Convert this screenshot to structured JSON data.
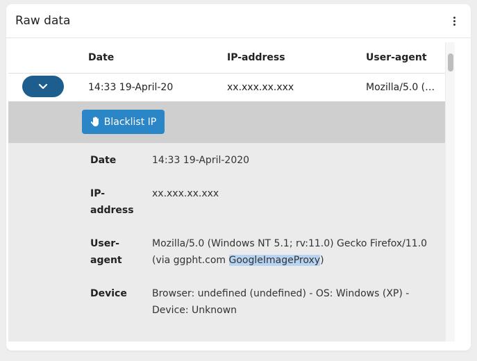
{
  "card": {
    "title": "Raw data",
    "menu_icon": "kebab-menu-icon"
  },
  "table": {
    "columns": [
      "Date",
      "IP-address",
      "User-agent"
    ],
    "row": {
      "date": "14:33 19-April-20",
      "ip": "xx.xxx.xx.xxx",
      "user_agent": "Mozilla/5.0 (…"
    }
  },
  "actions": {
    "blacklist_label": "Blacklist IP",
    "blacklist_icon": "hand-icon"
  },
  "details": {
    "date_label": "Date",
    "date_value": "14:33 19-April-2020",
    "ip_label_1": "IP-",
    "ip_label_2": "address",
    "ip_value": "xx.xxx.xx.xxx",
    "ua_label_1": "User-",
    "ua_label_2": "agent",
    "ua_value_1": "Mozilla/5.0 (Windows NT 5.1; rv:11.0) Gecko Firefox/11.0",
    "ua_value_2a": "(via ggpht.com ",
    "ua_value_2b": "GoogleImageProxy",
    "ua_value_2c": ")",
    "device_label": "Device",
    "device_value_1": "Browser: undefined (undefined) - OS: Windows (XP) -",
    "device_value_2": "Device: Unknown"
  },
  "colors": {
    "expand_button": "#1e5e8e",
    "blacklist_button": "#2a86c7",
    "action_bar": "#cfcfcf",
    "details_bg": "#ebebeb",
    "highlight": "#b7d4f3"
  }
}
